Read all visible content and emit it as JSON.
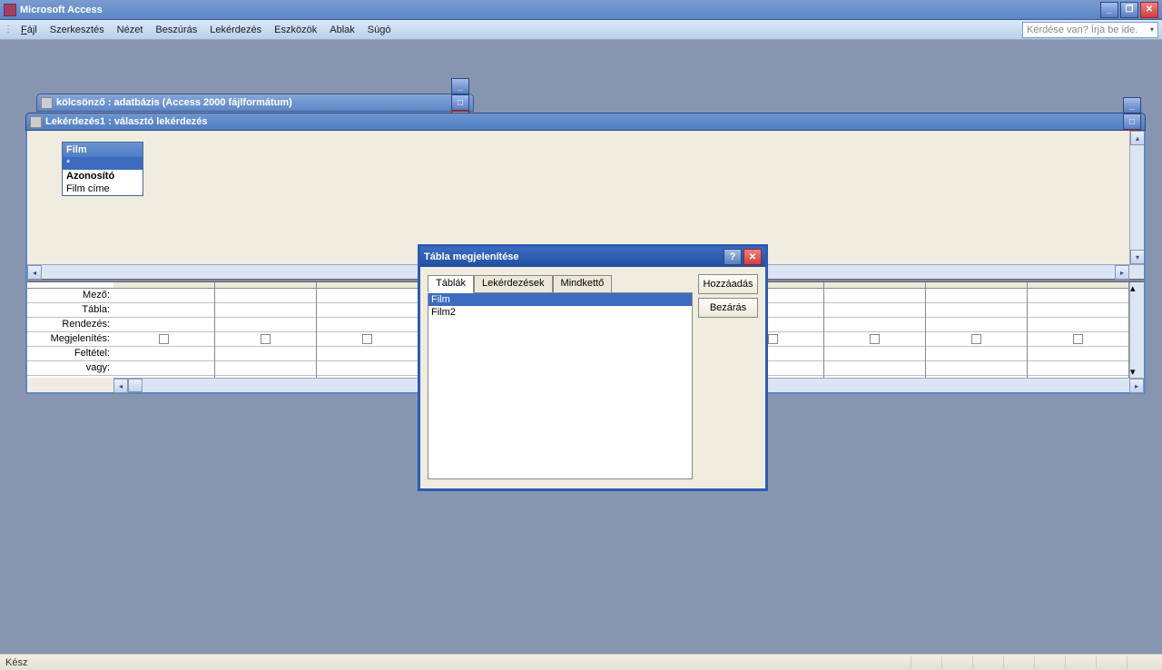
{
  "app": {
    "title": "Microsoft Access"
  },
  "menu": {
    "items": [
      {
        "label": "Fájl",
        "u": "F"
      },
      {
        "label": "Szerkesztés",
        "u": "S"
      },
      {
        "label": "Nézet",
        "u": "N"
      },
      {
        "label": "Beszúrás",
        "u": "B"
      },
      {
        "label": "Lekérdezés",
        "u": "L"
      },
      {
        "label": "Eszközök",
        "u": "E"
      },
      {
        "label": "Ablak",
        "u": "A"
      },
      {
        "label": "Súgó",
        "u": "S"
      }
    ],
    "help_placeholder": "Kérdése van? Írja be ide."
  },
  "db_window": {
    "title": "kölcsönző : adatbázis (Access 2000 fájlformátum)"
  },
  "query_window": {
    "title": "Lekérdezés1 : választó lekérdezés",
    "film_table": {
      "header": "Film",
      "fields": [
        "*",
        "Azonosító",
        "Film címe"
      ]
    },
    "grid_labels": [
      "Mező:",
      "Tábla:",
      "Rendezés:",
      "Megjelenítés:",
      "Feltétel:",
      "vagy:"
    ]
  },
  "show_table": {
    "title": "Tábla megjelenítése",
    "tabs": [
      "Táblák",
      "Lekérdezések",
      "Mindkettő"
    ],
    "items": [
      "Film",
      "Film2"
    ],
    "btn_add": "Hozzáadás",
    "btn_close": "Bezárás"
  },
  "status": {
    "text": "Kész"
  }
}
